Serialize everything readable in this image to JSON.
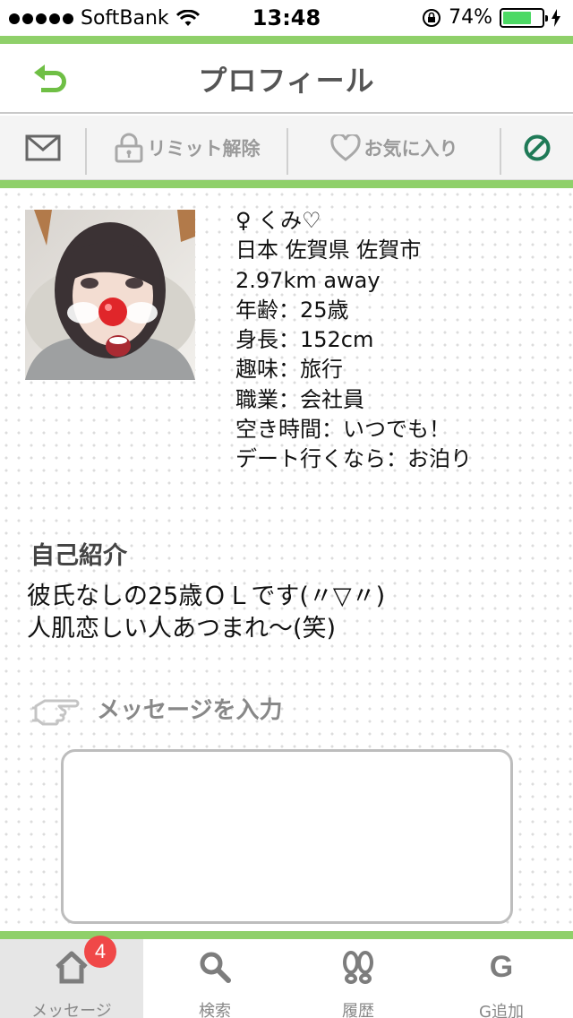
{
  "status_bar": {
    "carrier": "SoftBank",
    "time": "13:48",
    "battery": "74%",
    "battery_level": 0.74
  },
  "header": {
    "title": "プロフィール",
    "back_icon": "back-arrow-icon"
  },
  "toolbar": {
    "mail_icon": "envelope-icon",
    "limit_label": "リミット解除",
    "favorite_label": "お気に入り",
    "block_icon": "block-icon"
  },
  "profile": {
    "name_line": "♀ くみ♡",
    "location": "日本 佐賀県 佐賀市",
    "distance": "2.97km away",
    "age": "年齢：25歳",
    "height": "身長：152cm",
    "hobby": "趣味：旅行",
    "job": "職業：会社員",
    "free_time": "空き時間：いつでも！",
    "date_pref": "デート行くなら：お泊り"
  },
  "intro": {
    "heading": "自己紹介",
    "line1": " 彼氏なしの25歳ＯＬです(〃▽〃)",
    "line2": "人肌恋しい人あつまれ〜(笑)"
  },
  "message": {
    "label": "メッセージを入力",
    "value": ""
  },
  "tabs": [
    {
      "label": "メッセージ",
      "icon": "home-icon",
      "badge": "4"
    },
    {
      "label": "検索",
      "icon": "search-icon"
    },
    {
      "label": "履歴",
      "icon": "footprints-icon"
    },
    {
      "label": "G追加",
      "icon": "g-icon"
    }
  ],
  "colors": {
    "accent_green": "#8fd06a",
    "icon_green": "#1f7a57",
    "badge_red": "#f04848"
  }
}
